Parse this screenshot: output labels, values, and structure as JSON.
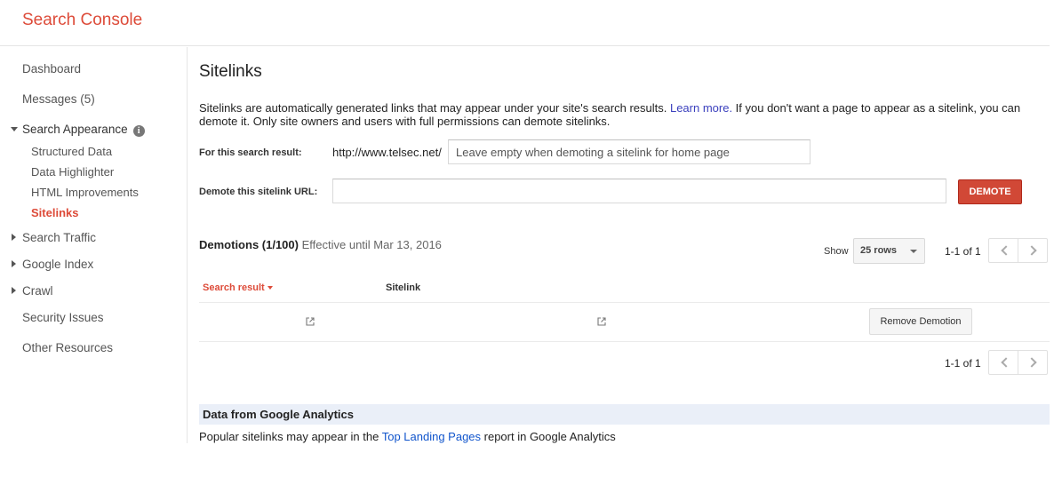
{
  "app": {
    "title": "Search Console"
  },
  "sidebar": {
    "dashboard": "Dashboard",
    "messages": "Messages (5)",
    "search_appearance": "Search Appearance",
    "info_glyph": "i",
    "sub_items": [
      "Structured Data",
      "Data Highlighter",
      "HTML Improvements",
      "Sitelinks"
    ],
    "active_item": "Sitelinks",
    "search_traffic": "Search Traffic",
    "google_index": "Google Index",
    "crawl": "Crawl",
    "security_issues": "Security Issues",
    "other_resources": "Other Resources"
  },
  "main": {
    "title": "Sitelinks",
    "desc_before_link": "Sitelinks are automatically generated links that may appear under your site's search results. ",
    "learn_more": "Learn more.",
    "desc_after_link": " If you don't want a page to appear as a sitelink, you can demote it. Only site owners and users with full permissions can demote sitelinks.",
    "form": {
      "search_result_label": "For this search result:",
      "url_prefix": "http://www.telsec.net/",
      "search_result_placeholder": "Leave empty when demoting a sitelink for home page",
      "demote_url_label": "Demote this sitelink URL:",
      "demote_url_value": "",
      "demote_button": "DEMOTE"
    },
    "demotions": {
      "title": "Demotions (1/100)",
      "effective": "Effective until Mar 13, 2016",
      "show_label": "Show",
      "rows_select": "25 rows",
      "range_top": "1-1 of 1",
      "range_bottom": "1-1 of 1",
      "columns": [
        "Search result",
        "Sitelink"
      ],
      "remove_button": "Remove Demotion"
    },
    "analytics": {
      "title": "Data from Google Analytics",
      "text_before": "Popular sitelinks may appear in the ",
      "link": "Top Landing Pages",
      "text_after": " report in Google Analytics"
    }
  },
  "colors": {
    "brand": "#dd4b39",
    "demote_button": "#d14836",
    "link": "#1155cc",
    "analytics_bar": "#eaeff8"
  }
}
